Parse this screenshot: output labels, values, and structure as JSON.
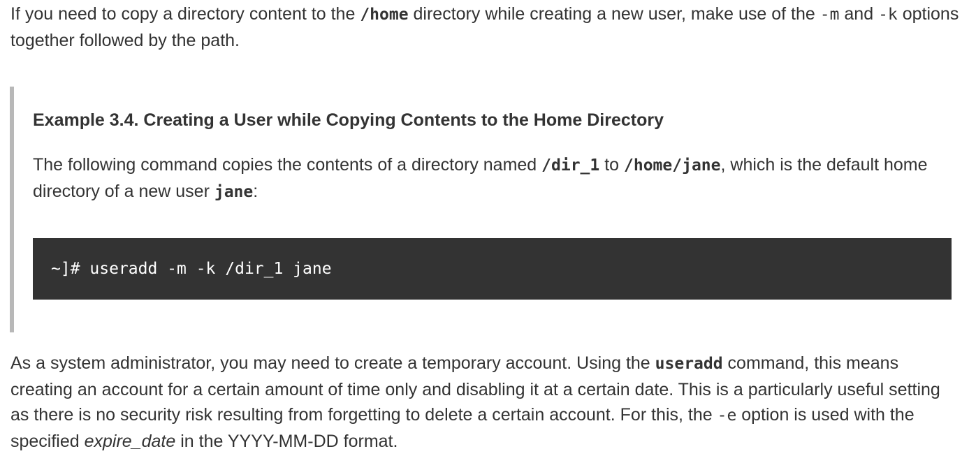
{
  "intro": {
    "t1": "If you need to copy a directory content to the ",
    "home_path": "/home",
    "t2": " directory while creating a new user, make use of the ",
    "opt_m": "-m",
    "t3": " and ",
    "opt_k": "-k",
    "t4": " options together followed by the path."
  },
  "example": {
    "title": "Example 3.4. Creating a User while Copying Contents to the Home Directory",
    "desc": {
      "t1": "The following command copies the contents of a directory named ",
      "dir": "/dir_1",
      "t2": " to ",
      "home": "/home/jane",
      "t3": ", which is the default home directory of a new user ",
      "user": "jane",
      "t4": ":"
    },
    "code": "~]# useradd -m -k /dir_1 jane"
  },
  "expire_para": {
    "t1": "As a system administrator, you may need to create a temporary account. Using the ",
    "cmd": "useradd",
    "t2": " command, this means creating an account for a certain amount of time only and disabling it at a certain date. This is a particularly useful setting as there is no security risk resulting from forgetting to delete a certain account. For this, the ",
    "opt_e": "-e",
    "t3": " option is used with the specified ",
    "expire_date": "expire_date",
    "t4": " in the YYYY-MM-DD format."
  }
}
